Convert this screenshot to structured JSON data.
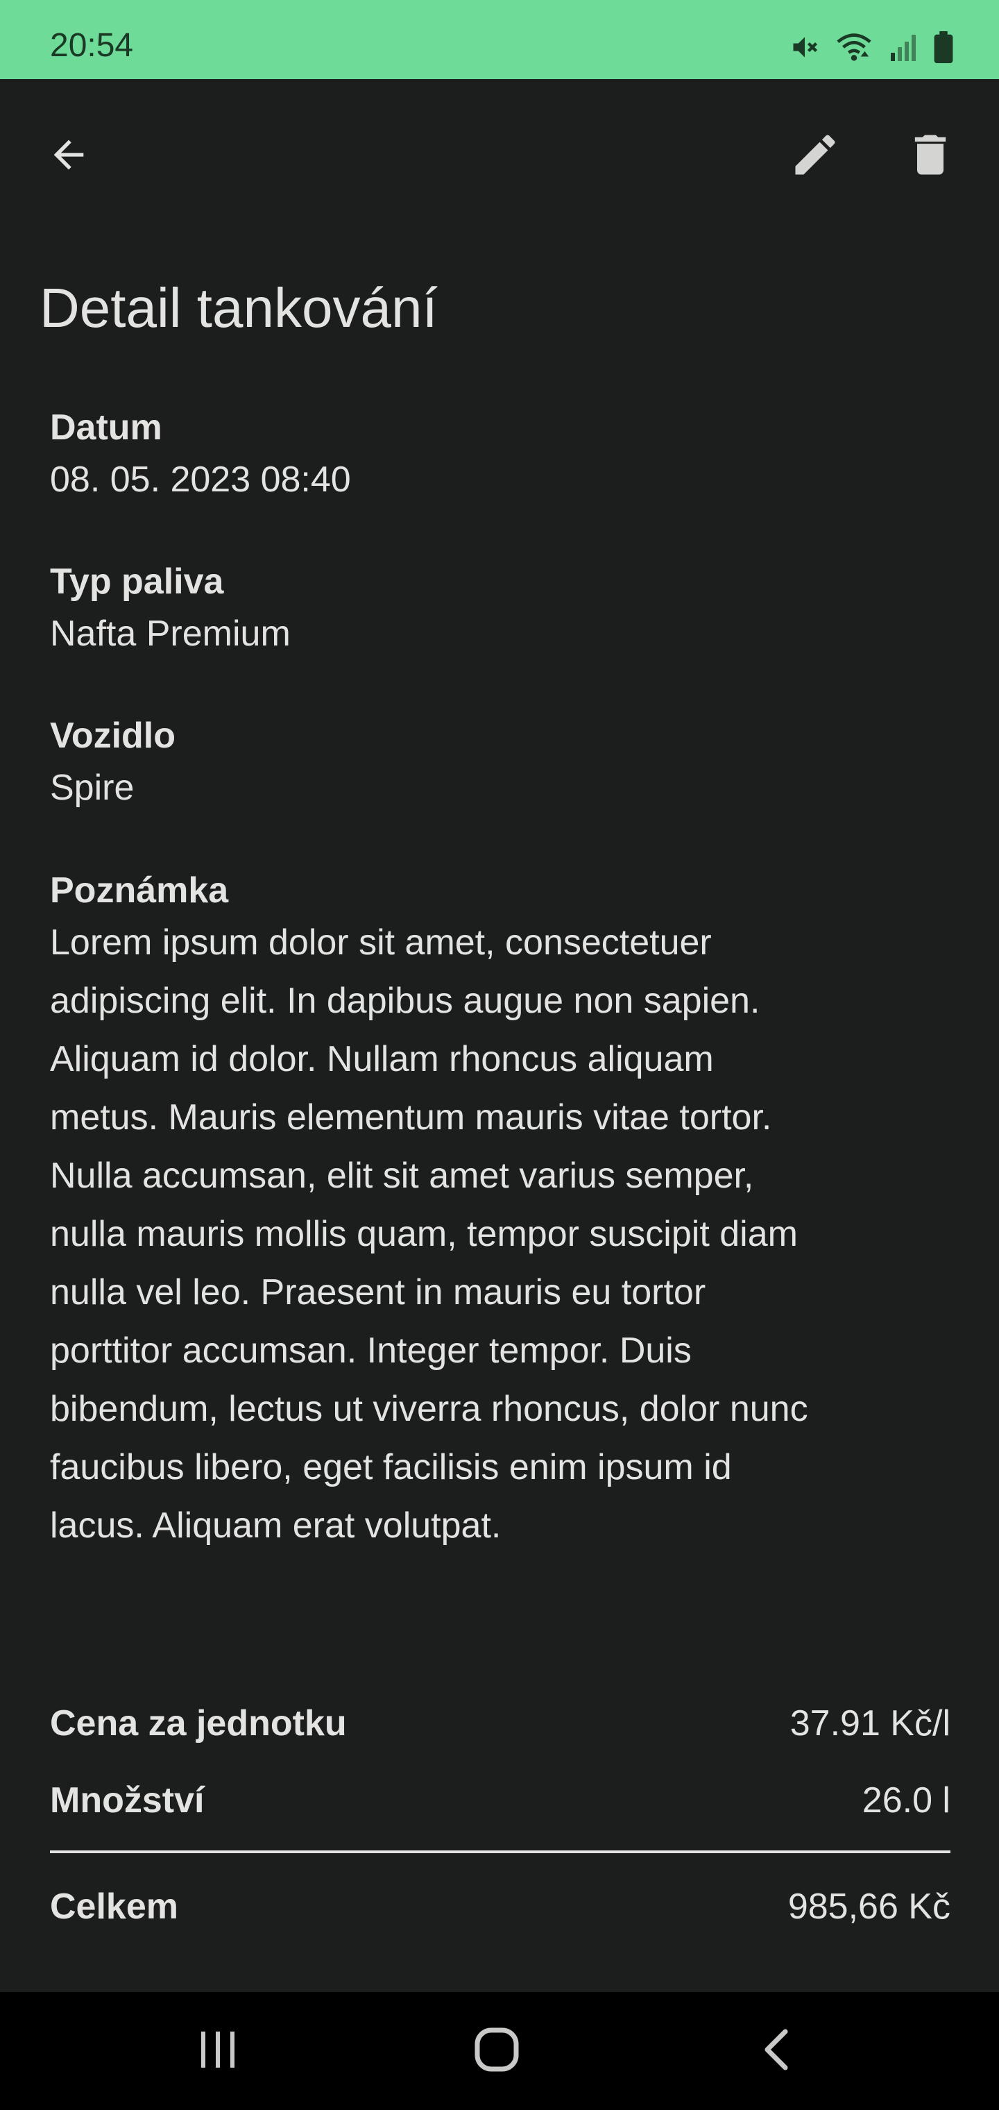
{
  "status_bar": {
    "time": "20:54",
    "icons": [
      "mute-icon",
      "wifi-icon",
      "signal-icon",
      "battery-icon"
    ],
    "background_color": "#6fdb99"
  },
  "toolbar": {
    "icons": [
      "arrow-back-icon",
      "edit-icon",
      "delete-icon"
    ]
  },
  "page": {
    "title": "Detail tankování"
  },
  "fields": {
    "date": {
      "label": "Datum",
      "value": "08. 05. 2023 08:40"
    },
    "fuel_type": {
      "label": "Typ paliva",
      "value": "Nafta Premium"
    },
    "vehicle": {
      "label": "Vozidlo",
      "value": "Spire"
    },
    "note": {
      "label": "Poznámka",
      "lines": [
        "Lorem ipsum dolor sit amet, consectetuer",
        "adipiscing elit. In dapibus augue non sapien.",
        "Aliquam id dolor. Nullam rhoncus aliquam",
        "metus. Mauris elementum mauris vitae tortor.",
        "Nulla accumsan, elit sit amet varius semper,",
        "nulla mauris mollis quam, tempor suscipit diam",
        "nulla vel leo. Praesent in mauris eu tortor",
        "porttitor accumsan. Integer tempor. Duis",
        "bibendum, lectus ut viverra rhoncus, dolor nunc",
        "faucibus libero, eget facilisis enim ipsum id",
        "lacus. Aliquam erat volutpat."
      ]
    }
  },
  "summary": {
    "unit_price": {
      "label": "Cena za jednotku",
      "value": "37.91 Kč/l"
    },
    "quantity": {
      "label": "Množství",
      "value": "26.0 l"
    },
    "total": {
      "label": "Celkem",
      "value": "985,66 Kč"
    }
  },
  "nav_bar": {
    "icons": [
      "recent-apps-icon",
      "home-icon",
      "back-icon"
    ]
  },
  "colors": {
    "background": "#1c1e1d",
    "text": "#e3e4e2",
    "status_bar": "#6fdb99",
    "nav_bar": "#000000"
  }
}
